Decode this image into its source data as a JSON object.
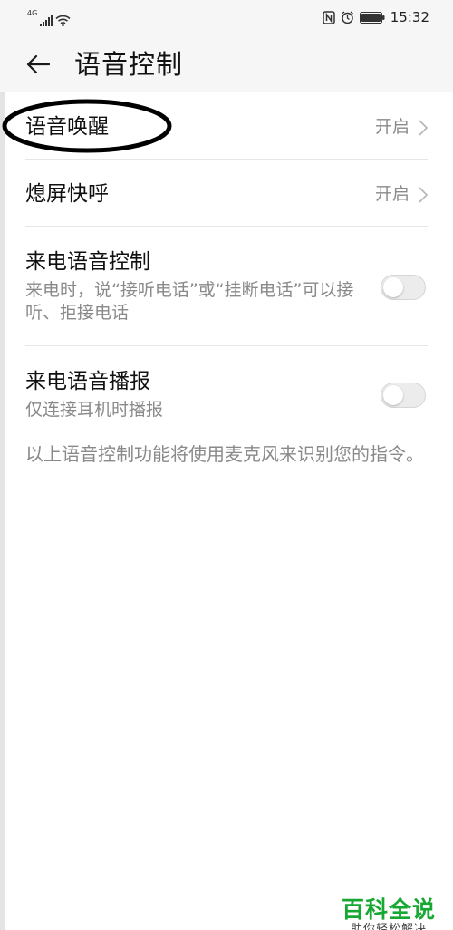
{
  "status_bar": {
    "network": "4G",
    "time": "15:32",
    "icons": [
      "signal-icon",
      "wifi-icon",
      "nfc-icon",
      "alarm-icon",
      "battery-icon"
    ]
  },
  "header": {
    "title": "语音控制",
    "back_icon": "back-arrow-icon"
  },
  "settings": {
    "voice_wakeup": {
      "label": "语音唤醒",
      "value": "开启"
    },
    "screen_off_call": {
      "label": "熄屏快呼",
      "value": "开启"
    },
    "incoming_voice_control": {
      "label": "来电语音控制",
      "description": "来电时，说“接听电话”或“挂断电话”可以接听、拒接电话",
      "enabled": false
    },
    "incoming_voice_announce": {
      "label": "来电语音播报",
      "description": "仅连接耳机时播报",
      "enabled": false
    }
  },
  "footnote": "以上语音控制功能将使用麦克风来识别您的指令。",
  "watermark": {
    "main": "百科全说",
    "sub": "助你轻松解决"
  },
  "colors": {
    "background": "#ffffff",
    "header_background": "#f6f6f6",
    "secondary_text": "#8a8a8a",
    "watermark_green": "#16a832"
  }
}
